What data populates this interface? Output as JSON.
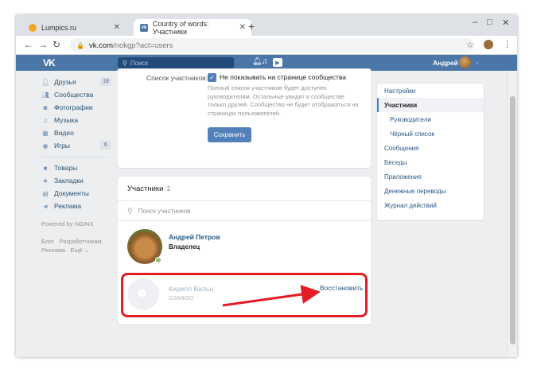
{
  "browser": {
    "tabs": [
      {
        "title": "Lumpics.ru"
      },
      {
        "title": "Country of words: Участники"
      }
    ],
    "new_tab_symbol": "+",
    "address": {
      "host": "vk.com",
      "path": "/nokgp?act=users"
    },
    "window_controls": [
      "–",
      "□",
      "✕"
    ]
  },
  "vk_header": {
    "logo": "VK",
    "search_placeholder": "Поиск",
    "user_name": "Андрей"
  },
  "left_menu": {
    "items": [
      {
        "label": "Друзья",
        "icon": "person-icon",
        "count": "18"
      },
      {
        "label": "Сообщества",
        "icon": "group-icon",
        "count": ""
      },
      {
        "label": "Фотографии",
        "icon": "camera-icon",
        "count": ""
      },
      {
        "label": "Музыка",
        "icon": "music-icon",
        "count": ""
      },
      {
        "label": "Видео",
        "icon": "video-icon",
        "count": ""
      },
      {
        "label": "Игры",
        "icon": "gamepad-icon",
        "count": "6"
      }
    ],
    "items2": [
      {
        "label": "Товары",
        "icon": "bag-icon"
      },
      {
        "label": "Закладки",
        "icon": "star-icon"
      },
      {
        "label": "Документы",
        "icon": "document-icon"
      },
      {
        "label": "Реклама",
        "icon": "megaphone-icon"
      }
    ],
    "powered": "Powered by NGINX",
    "footer_links": [
      "Блог",
      "Разработчикам",
      "Реклама",
      "Ещё"
    ]
  },
  "settings_card": {
    "label": "Список участников:",
    "checkbox_label": "Не показывать на странице сообщества",
    "hint": "Полный список участников будет доступен руководителям. Остальные увидят в сообществе только друзей. Сообщество не будет отображаться на страницах пользователей.",
    "save_label": "Сохранить"
  },
  "members_card": {
    "title": "Участники",
    "count": "1",
    "search_placeholder": "Поиск участников",
    "members": [
      {
        "name": "Андрей Петров",
        "role": "Владелец"
      },
      {
        "name": "Кирилл Вальц",
        "sub": "DJANGO",
        "action": "Восстановить"
      }
    ]
  },
  "right_menu": {
    "items": [
      {
        "label": "Настройки",
        "type": "normal"
      },
      {
        "label": "Участники",
        "type": "active"
      },
      {
        "label": "Руководители",
        "type": "sub"
      },
      {
        "label": "Чёрный список",
        "type": "sub"
      },
      {
        "label": "Сообщения",
        "type": "normal"
      },
      {
        "label": "Беседы",
        "type": "normal"
      },
      {
        "label": "Приложения",
        "type": "normal"
      },
      {
        "label": "Денежные переводы",
        "type": "normal"
      },
      {
        "label": "Журнал действий",
        "type": "normal"
      }
    ]
  },
  "colors": {
    "vk_blue": "#4a76a8",
    "link": "#2a5885",
    "highlight": "#e31c25"
  }
}
